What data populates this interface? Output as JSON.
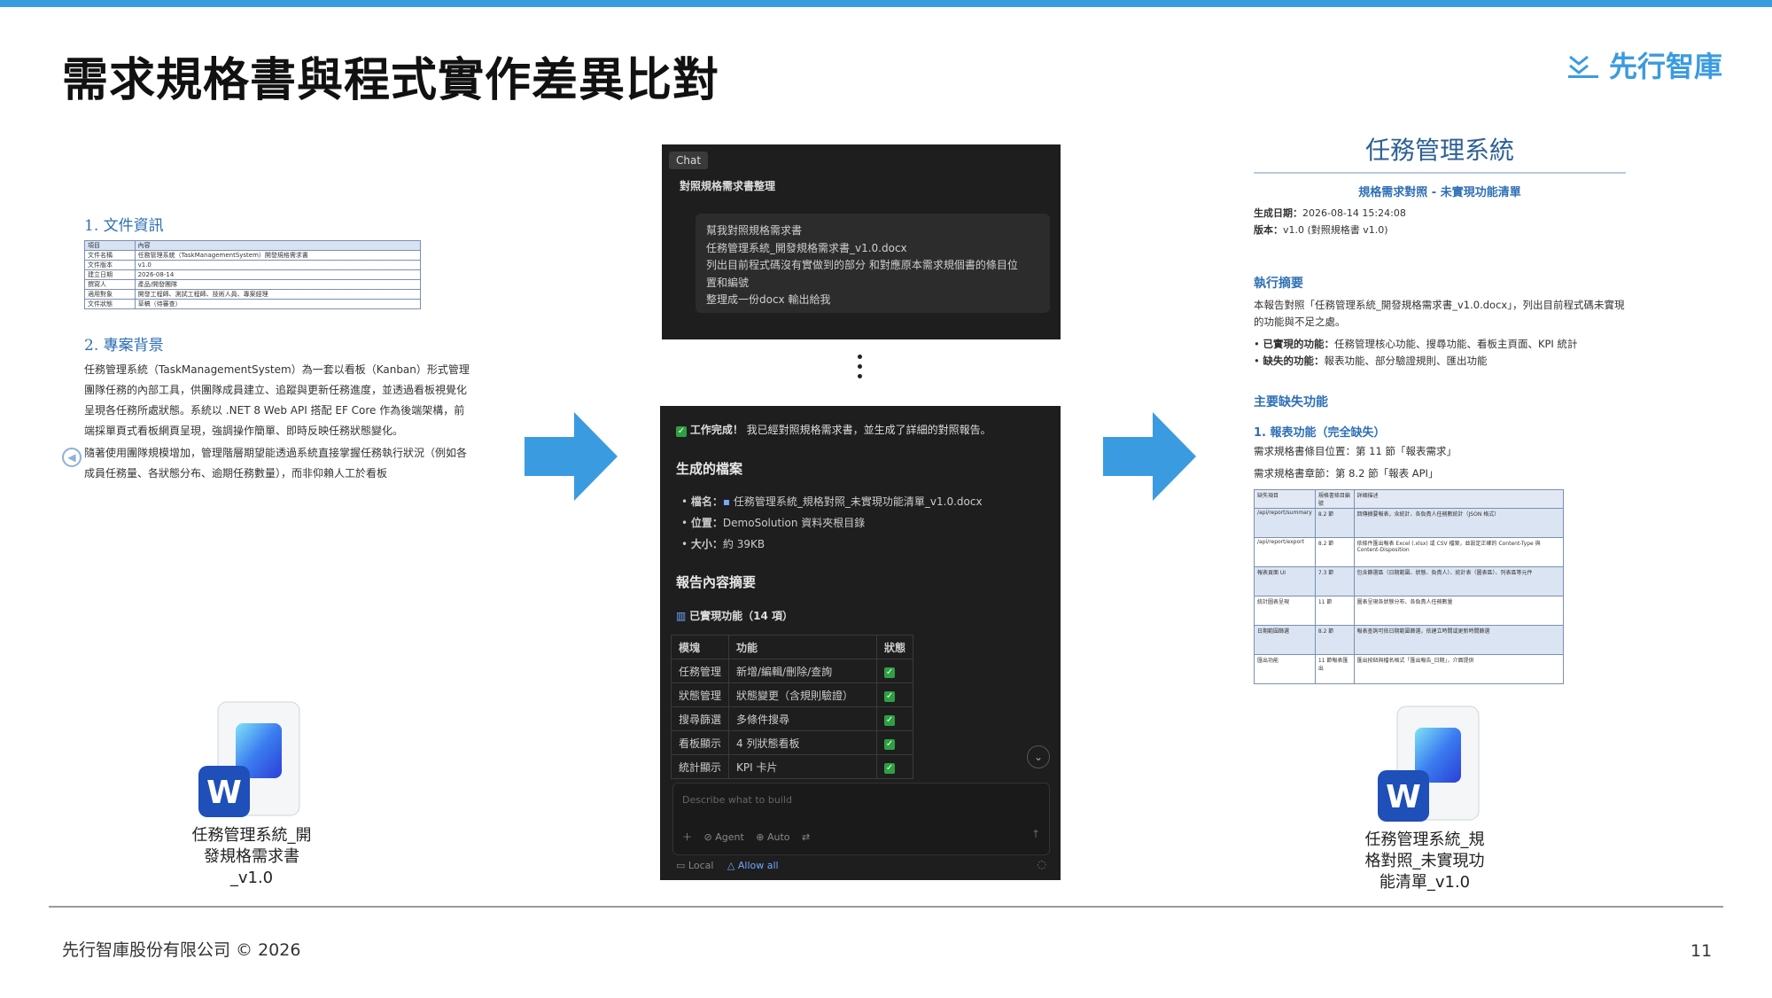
{
  "slide": {
    "title": "需求規格書與程式實作差異比對",
    "logo_text": "先行智庫",
    "footer": "先行智庫股份有限公司 © 2026",
    "page_number": "11",
    "accent_color": "#3b9be0"
  },
  "left_doc": {
    "section1": "1. 文件資訊",
    "table_rows": [
      [
        "項目",
        "內容"
      ],
      [
        "文件名稱",
        "任務管理系統（TaskManagementSystem）開發規格需求書"
      ],
      [
        "文件版本",
        "v1.0"
      ],
      [
        "建立日期",
        "2026-08-14"
      ],
      [
        "撰寫人",
        "產品/開發團隊"
      ],
      [
        "適用對象",
        "開發工程師、測試工程師、技術人員、專案經理"
      ],
      [
        "文件狀態",
        "草稿（待審查）"
      ]
    ],
    "section2": "2. 專案背景",
    "para1": "任務管理系統（TaskManagementSystem）為一套以看板（Kanban）形式管理團隊任務的內部工具，供團隊成員建立、追蹤與更新任務進度，並透過看板視覺化呈現各任務所處狀態。系統以 .NET 8 Web API 搭配 EF Core 作為後端架構，前端採單頁式看板網頁呈現，強調操作簡單、即時反映任務狀態變化。",
    "para2": "隨著使用團隊規模增加，管理階層期望能透過系統直接掌握任務執行狀況（例如各成員任務量、各狀態分布、逾期任務數量），而非仰賴人工於看板"
  },
  "left_file": {
    "label_lines": [
      "任務管理系統_開",
      "發規格需求書",
      "_v1.0"
    ]
  },
  "chat_top": {
    "chip": "Chat",
    "title": "對照規格需求書整理",
    "message_lines": [
      "幫我對照規格需求書",
      "任務管理系統_開發規格需求書_v1.0.docx",
      "列出目前程式碼沒有實做到的部分 和對應原本需求規個書的條目位",
      "置和編號",
      "整理成一份docx 輸出給我"
    ]
  },
  "chat_bottom": {
    "done_label": "工作完成！",
    "done_text": "我已經對照規格需求書，並生成了詳細的對照報告。",
    "files_heading": "生成的檔案",
    "file_name_label": "檔名：",
    "file_name": "任務管理系統_規格對照_未實現功能清單_v1.0.docx",
    "location_label": "位置：",
    "location": "DemoSolution 資料夾根目錄",
    "size_label": "大小：",
    "size": "約 39KB",
    "summary_heading": "報告內容摘要",
    "implemented_label": "已實現功能（14 項）",
    "table_headers": [
      "模塊",
      "功能",
      "狀態"
    ],
    "table_rows": [
      [
        "任務管理",
        "新增/編輯/刪除/查詢"
      ],
      [
        "狀態管理",
        "狀態變更（含規則驗證）"
      ],
      [
        "搜尋篩選",
        "多條件搜尋"
      ],
      [
        "看板顯示",
        "4 列狀態看板"
      ],
      [
        "統計顯示",
        "KPI 卡片"
      ]
    ],
    "input_placeholder": "Describe what to build",
    "agent_label": "Agent",
    "auto_label": "Auto",
    "local_label": "Local",
    "allow_all_label": "Allow all"
  },
  "right_doc": {
    "title": "任務管理系統",
    "subtitle": "規格需求對照 - 未實現功能清單",
    "date_label": "生成日期：",
    "date": "2026-08-14 15:24:08",
    "version_label": "版本：",
    "version": "v1.0 (對照規格書 v1.0)",
    "summary_heading": "執行摘要",
    "summary_text": "本報告對照「任務管理系統_開發規格需求書_v1.0.docx」，列出目前程式碼未實現的功能與不足之處。",
    "implemented_label": "已實現的功能：",
    "implemented_text": "任務管理核心功能、搜尋功能、看板主頁面、KPI 統計",
    "missing_label": "缺失的功能：",
    "missing_text": "報表功能、部分驗證規則、匯出功能",
    "missing_heading": "主要缺失功能",
    "item1_heading": "1. 報表功能（完全缺失）",
    "item1_line1": "需求規格書條目位置：第 11 節「報表需求」",
    "item1_line2": "需求規格書章節：第 8.2 節「報表 API」",
    "table_rows": [
      [
        "缺失項目",
        "規格書條目編號",
        "詳細描述"
      ],
      [
        "/api/report/summary",
        "8.2 節",
        "回傳摘要報表，含統計、各負責人任務數統計（JSON 格式）"
      ],
      [
        "/api/report/export",
        "8.2 節",
        "依條件匯出報表 Excel (.xlsx) 或 CSV 檔案，並設定正確的 Content-Type 與 Content-Disposition"
      ],
      [
        "報表頁面 UI",
        "7.3 節",
        "包含篩選區（日期範圍、狀態、負責人）、統計表（圖表區）、列表區等元件"
      ],
      [
        "統計圖表呈現",
        "11 節",
        "圖表呈現各狀態分布、各負責人任務數量"
      ],
      [
        "日期範圍篩選",
        "8.2 節",
        "報表查詢可依日期範圍篩選，依建立時間或更新時間篩選"
      ],
      [
        "匯出功能",
        "11 節報表匯出",
        "匯出按鈕與檔名格式「匯出報告_日期」，介面提供"
      ]
    ]
  },
  "right_file": {
    "label_lines": [
      "任務管理系統_規",
      "格對照_未實現功",
      "能清單_v1.0"
    ]
  }
}
